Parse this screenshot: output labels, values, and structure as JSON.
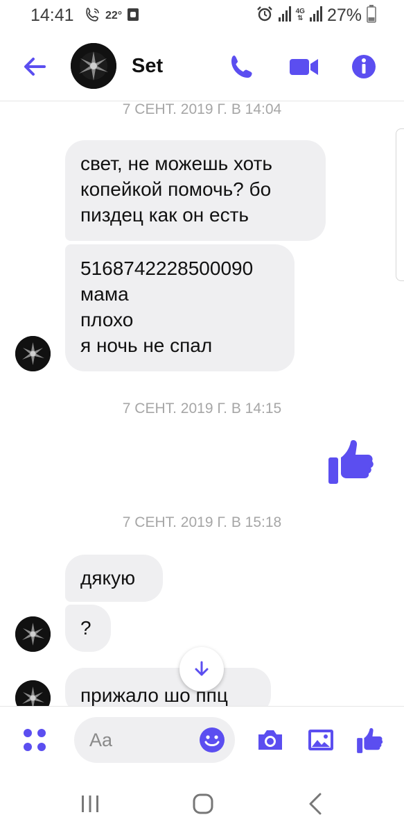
{
  "status_bar": {
    "time": "14:41",
    "temperature": "22°",
    "network": "4G",
    "battery": "27%"
  },
  "header": {
    "contact_name": "Set"
  },
  "conversation": {
    "timestamps": [
      "7 СЕНТ. 2019 Г. В 14:04",
      "7 СЕНТ. 2019 Г. В 14:15",
      "7 СЕНТ. 2019 Г. В 15:18"
    ],
    "messages": [
      {
        "lines": [
          "свет, не можешь хоть",
          "копейкой помочь? бо",
          "пиздец как он есть"
        ]
      },
      {
        "lines": [
          "5168742228500090",
          "мама",
          "плохо",
          "я ночь не спал"
        ]
      },
      {
        "lines": [
          "дякую"
        ]
      },
      {
        "lines": [
          "?"
        ]
      },
      {
        "lines": [
          "прижало шо ппц"
        ]
      }
    ]
  },
  "composer": {
    "placeholder": "Aa"
  },
  "colors": {
    "accent": "#5b4ef0",
    "bubble_bg": "#efeff1",
    "timestamp": "#a6a6a6"
  },
  "icons": [
    "arrow-left-icon",
    "phone-icon",
    "video-camera-icon",
    "info-icon",
    "thumbs-up-icon",
    "arrow-down-icon",
    "grid-dots-icon",
    "smiley-icon",
    "camera-icon",
    "image-icon",
    "recents-icon",
    "home-icon",
    "back-icon"
  ]
}
